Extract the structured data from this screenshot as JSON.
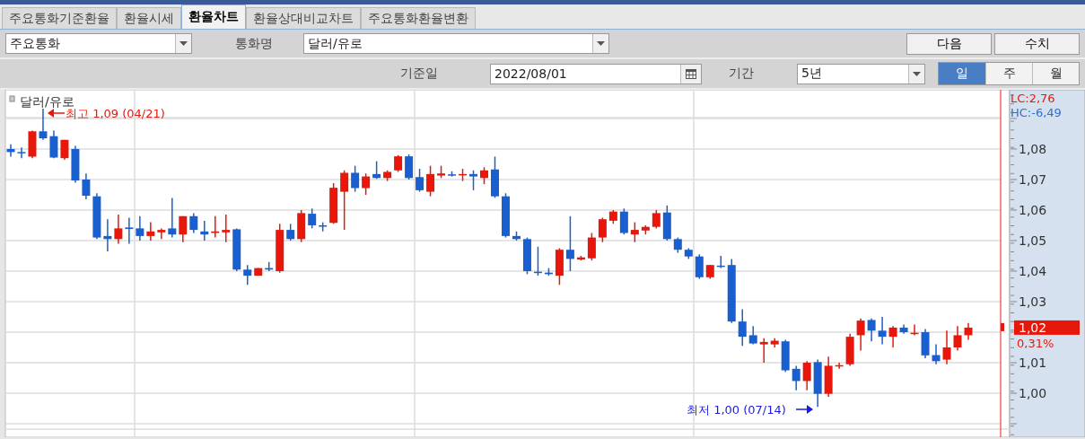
{
  "tabs": [
    {
      "label": "주요통화기준환율",
      "selected": false
    },
    {
      "label": "환율시세",
      "selected": false
    },
    {
      "label": "환율차트",
      "selected": true
    },
    {
      "label": "환율상대비교차트",
      "selected": false
    },
    {
      "label": "주요통화환율변환",
      "selected": false
    }
  ],
  "filter_bar": {
    "category_select": {
      "value": "주요통화"
    },
    "currency_label": "통화명",
    "currency_select": {
      "value": "달러/유로"
    },
    "buttons": [
      "다음",
      "수치"
    ]
  },
  "date_bar": {
    "date_label": "기준일",
    "date_field": {
      "value": "2022/08/01"
    },
    "period_label": "기간",
    "period_select": {
      "value": "5년"
    },
    "interval_toggle": [
      {
        "label": "일",
        "selected": true
      },
      {
        "label": "주",
        "selected": false
      },
      {
        "label": "월",
        "selected": false
      }
    ]
  },
  "chart": {
    "legend": "달러/유로",
    "high_note": "최고 1,09 (04/21)",
    "low_note": "최저 1,00 (07/14)",
    "lc": "LC:2,76",
    "hc": "HC:-6,49",
    "last_price": "1,02",
    "change": "0,31%",
    "chart_data": {
      "type": "candlestick",
      "grid": true,
      "ylim": [
        0.9856,
        1.0994
      ],
      "yticks": [
        {
          "value": 1.0,
          "label": "1,00"
        },
        {
          "value": 1.01,
          "label": "1,01"
        },
        {
          "value": 1.03,
          "label": "1,03"
        },
        {
          "value": 1.04,
          "label": "1,04"
        },
        {
          "value": 1.05,
          "label": "1,05"
        },
        {
          "value": 1.06,
          "label": "1,06"
        },
        {
          "value": 1.07,
          "label": "1,07"
        },
        {
          "value": 1.08,
          "label": "1,08"
        }
      ],
      "ohlc": [
        [
          1.08,
          1.0815,
          1.0775,
          1.079
        ],
        [
          1.079,
          1.0805,
          1.077,
          1.0787
        ],
        [
          1.0775,
          1.086,
          1.077,
          1.0858
        ],
        [
          1.0858,
          1.0932,
          1.083,
          1.0835
        ],
        [
          1.0842,
          1.086,
          1.077,
          1.0772
        ],
        [
          1.077,
          1.083,
          1.0765,
          1.083
        ],
        [
          1.08,
          1.081,
          1.069,
          1.0697
        ],
        [
          1.07,
          1.072,
          1.0635,
          1.0647
        ],
        [
          1.0645,
          1.0655,
          1.0505,
          1.051
        ],
        [
          1.0515,
          1.057,
          1.0465,
          1.0505
        ],
        [
          1.0505,
          1.0585,
          1.049,
          1.054
        ],
        [
          1.0543,
          1.0575,
          1.049,
          1.0538
        ],
        [
          1.054,
          1.058,
          1.05,
          1.0515
        ],
        [
          1.0515,
          1.056,
          1.05,
          1.053
        ],
        [
          1.0527,
          1.054,
          1.0505,
          1.0535
        ],
        [
          1.054,
          1.064,
          1.051,
          1.052
        ],
        [
          1.052,
          1.058,
          1.0495,
          1.058
        ],
        [
          1.058,
          1.059,
          1.0525,
          1.0535
        ],
        [
          1.053,
          1.0565,
          1.05,
          1.052
        ],
        [
          1.0525,
          1.058,
          1.051,
          1.053
        ],
        [
          1.0527,
          1.0585,
          1.0495,
          1.0535
        ],
        [
          1.0537,
          1.054,
          1.04,
          1.0405
        ],
        [
          1.0405,
          1.042,
          1.0355,
          1.0385
        ],
        [
          1.0385,
          1.041,
          1.0385,
          1.041
        ],
        [
          1.041,
          1.043,
          1.04,
          1.0405
        ],
        [
          1.04,
          1.0555,
          1.0395,
          1.0535
        ],
        [
          1.0535,
          1.0555,
          1.05,
          1.0505
        ],
        [
          1.0505,
          1.06,
          1.0495,
          1.059
        ],
        [
          1.0588,
          1.0605,
          1.054,
          1.055
        ],
        [
          1.055,
          1.056,
          1.053,
          1.0548
        ],
        [
          1.0558,
          1.0688,
          1.0555,
          1.0673
        ],
        [
          1.066,
          1.073,
          1.0535,
          1.0722
        ],
        [
          1.0722,
          1.0745,
          1.066,
          1.0672
        ],
        [
          1.0672,
          1.072,
          1.065,
          1.071
        ],
        [
          1.0718,
          1.076,
          1.0702,
          1.0705
        ],
        [
          1.0705,
          1.073,
          1.0695,
          1.0725
        ],
        [
          1.073,
          1.078,
          1.0725,
          1.0776
        ],
        [
          1.0776,
          1.0782,
          1.07,
          1.0705
        ],
        [
          1.0708,
          1.0735,
          1.066,
          1.0665
        ],
        [
          1.066,
          1.0745,
          1.0645,
          1.0718
        ],
        [
          1.0713,
          1.0745,
          1.0705,
          1.072
        ],
        [
          1.0717,
          1.0727,
          1.071,
          1.0715
        ],
        [
          1.0714,
          1.0735,
          1.0695,
          1.0718
        ],
        [
          1.0718,
          1.073,
          1.0665,
          1.071
        ],
        [
          1.0705,
          1.074,
          1.0685,
          1.073
        ],
        [
          1.0733,
          1.0775,
          1.064,
          1.0645
        ],
        [
          1.0645,
          1.0655,
          1.051,
          1.0515
        ],
        [
          1.0515,
          1.053,
          1.05,
          1.0505
        ],
        [
          1.0505,
          1.051,
          1.039,
          1.04
        ],
        [
          1.0398,
          1.048,
          1.0385,
          1.0395
        ],
        [
          1.0395,
          1.041,
          1.0385,
          1.039
        ],
        [
          1.0385,
          1.0475,
          1.0355,
          1.047
        ],
        [
          1.047,
          1.058,
          1.04,
          1.044
        ],
        [
          1.0438,
          1.045,
          1.0435,
          1.0445
        ],
        [
          1.0442,
          1.0525,
          1.0435,
          1.051
        ],
        [
          1.051,
          1.0575,
          1.0495,
          1.057
        ],
        [
          1.0565,
          1.06,
          1.0555,
          1.0595
        ],
        [
          1.0595,
          1.0605,
          1.052,
          1.0525
        ],
        [
          1.052,
          1.056,
          1.0495,
          1.0535
        ],
        [
          1.0533,
          1.055,
          1.052,
          1.0545
        ],
        [
          1.0545,
          1.06,
          1.054,
          1.059
        ],
        [
          1.0592,
          1.0615,
          1.05,
          1.0505
        ],
        [
          1.0505,
          1.051,
          1.046,
          1.047
        ],
        [
          1.047,
          1.0475,
          1.044,
          1.0448
        ],
        [
          1.0448,
          1.0455,
          1.0375,
          1.038
        ],
        [
          1.038,
          1.042,
          1.0375,
          1.042
        ],
        [
          1.0418,
          1.045,
          1.041,
          1.0414
        ],
        [
          1.042,
          1.044,
          1.023,
          1.0235
        ],
        [
          1.0235,
          1.0275,
          1.0155,
          1.0185
        ],
        [
          1.019,
          1.022,
          1.016,
          1.0163
        ],
        [
          1.016,
          1.018,
          1.01,
          1.0168
        ],
        [
          1.016,
          1.018,
          1.015,
          1.0172
        ],
        [
          1.017,
          1.0175,
          1.007,
          1.0075
        ],
        [
          1.008,
          1.009,
          1.001,
          1.004
        ],
        [
          1.004,
          1.0105,
          1.001,
          1.01
        ],
        [
          1.0102,
          1.011,
          0.9955,
          0.9998
        ],
        [
          0.9998,
          1.012,
          0.9988,
          1.009
        ],
        [
          1.0088,
          1.01,
          1.008,
          1.0092
        ],
        [
          1.0095,
          1.0195,
          1.009,
          1.0185
        ],
        [
          1.019,
          1.0245,
          1.014,
          1.0238
        ],
        [
          1.024,
          1.0245,
          1.017,
          1.0205
        ],
        [
          1.0205,
          1.025,
          1.016,
          1.0185
        ],
        [
          1.0185,
          1.022,
          1.015,
          1.0215
        ],
        [
          1.0215,
          1.0225,
          1.0195,
          1.02
        ],
        [
          1.0195,
          1.0225,
          1.019,
          1.0198
        ],
        [
          1.02,
          1.021,
          1.0115,
          1.0124
        ],
        [
          1.0125,
          1.016,
          1.0095,
          1.0105
        ],
        [
          1.011,
          1.0205,
          1.0095,
          1.015
        ],
        [
          1.015,
          1.022,
          1.014,
          1.019
        ],
        [
          1.019,
          1.023,
          1.0175,
          1.0215
        ]
      ]
    }
  }
}
